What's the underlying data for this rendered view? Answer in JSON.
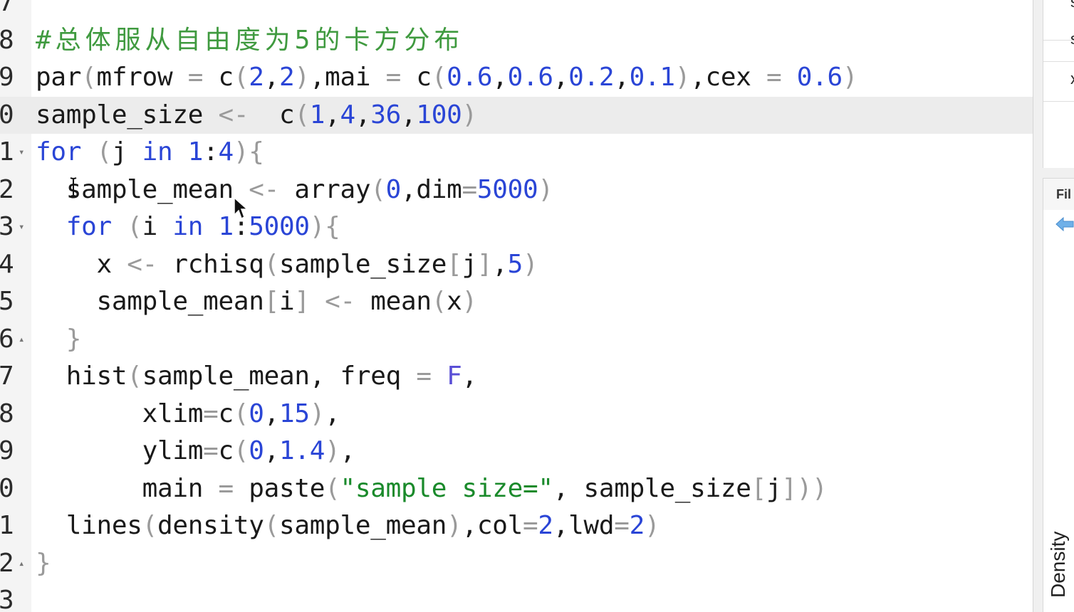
{
  "editor": {
    "lines": [
      {
        "num": "7",
        "fold": "",
        "tokens": []
      },
      {
        "num": "8",
        "fold": "",
        "tokens": [
          {
            "t": "comment",
            "v": "#总体服从自由度为5的卡方分布"
          }
        ]
      },
      {
        "num": "9",
        "fold": "",
        "tokens": [
          {
            "t": "default",
            "v": "par"
          },
          {
            "t": "paren",
            "v": "("
          },
          {
            "t": "default",
            "v": "mfrow "
          },
          {
            "t": "op",
            "v": "="
          },
          {
            "t": "default",
            "v": " c"
          },
          {
            "t": "paren",
            "v": "("
          },
          {
            "t": "number",
            "v": "2"
          },
          {
            "t": "default",
            "v": ","
          },
          {
            "t": "number",
            "v": "2"
          },
          {
            "t": "paren",
            "v": ")"
          },
          {
            "t": "default",
            "v": ",mai "
          },
          {
            "t": "op",
            "v": "="
          },
          {
            "t": "default",
            "v": " c"
          },
          {
            "t": "paren",
            "v": "("
          },
          {
            "t": "number",
            "v": "0.6"
          },
          {
            "t": "default",
            "v": ","
          },
          {
            "t": "number",
            "v": "0.6"
          },
          {
            "t": "default",
            "v": ","
          },
          {
            "t": "number",
            "v": "0.2"
          },
          {
            "t": "default",
            "v": ","
          },
          {
            "t": "number",
            "v": "0.1"
          },
          {
            "t": "paren",
            "v": ")"
          },
          {
            "t": "default",
            "v": ",cex "
          },
          {
            "t": "op",
            "v": "="
          },
          {
            "t": "default",
            "v": " "
          },
          {
            "t": "number",
            "v": "0.6"
          },
          {
            "t": "paren",
            "v": ")"
          }
        ]
      },
      {
        "num": "0",
        "fold": "",
        "current": true,
        "tokens": [
          {
            "t": "default",
            "v": "sample_size "
          },
          {
            "t": "op",
            "v": "<-"
          },
          {
            "t": "default",
            "v": "  c"
          },
          {
            "t": "paren",
            "v": "("
          },
          {
            "t": "number",
            "v": "1"
          },
          {
            "t": "default",
            "v": ","
          },
          {
            "t": "number",
            "v": "4"
          },
          {
            "t": "default",
            "v": ","
          },
          {
            "t": "number",
            "v": "36"
          },
          {
            "t": "default",
            "v": ","
          },
          {
            "t": "number",
            "v": "100"
          },
          {
            "t": "paren",
            "v": ")"
          }
        ]
      },
      {
        "num": "1",
        "fold": "▾",
        "tokens": [
          {
            "t": "keyword",
            "v": "for"
          },
          {
            "t": "default",
            "v": " "
          },
          {
            "t": "paren",
            "v": "("
          },
          {
            "t": "default",
            "v": "j "
          },
          {
            "t": "keyword",
            "v": "in"
          },
          {
            "t": "default",
            "v": " "
          },
          {
            "t": "number",
            "v": "1"
          },
          {
            "t": "default",
            "v": ":"
          },
          {
            "t": "number",
            "v": "4"
          },
          {
            "t": "paren",
            "v": ")"
          },
          {
            "t": "paren",
            "v": "{"
          }
        ]
      },
      {
        "num": "2",
        "fold": "",
        "tokens": [
          {
            "t": "default",
            "v": "  sample_mean "
          },
          {
            "t": "op",
            "v": "<-"
          },
          {
            "t": "default",
            "v": " array"
          },
          {
            "t": "paren",
            "v": "("
          },
          {
            "t": "number",
            "v": "0"
          },
          {
            "t": "default",
            "v": ",dim"
          },
          {
            "t": "op",
            "v": "="
          },
          {
            "t": "number",
            "v": "5000"
          },
          {
            "t": "paren",
            "v": ")"
          }
        ]
      },
      {
        "num": "3",
        "fold": "▾",
        "tokens": [
          {
            "t": "default",
            "v": "  "
          },
          {
            "t": "keyword",
            "v": "for"
          },
          {
            "t": "default",
            "v": " "
          },
          {
            "t": "paren",
            "v": "("
          },
          {
            "t": "default",
            "v": "i "
          },
          {
            "t": "keyword",
            "v": "in"
          },
          {
            "t": "default",
            "v": " "
          },
          {
            "t": "number",
            "v": "1"
          },
          {
            "t": "default",
            "v": ":"
          },
          {
            "t": "number",
            "v": "5000"
          },
          {
            "t": "paren",
            "v": ")"
          },
          {
            "t": "paren",
            "v": "{"
          }
        ]
      },
      {
        "num": "4",
        "fold": "",
        "tokens": [
          {
            "t": "default",
            "v": "    x "
          },
          {
            "t": "op",
            "v": "<-"
          },
          {
            "t": "default",
            "v": " rchisq"
          },
          {
            "t": "paren",
            "v": "("
          },
          {
            "t": "default",
            "v": "sample_size"
          },
          {
            "t": "paren",
            "v": "["
          },
          {
            "t": "default",
            "v": "j"
          },
          {
            "t": "paren",
            "v": "]"
          },
          {
            "t": "default",
            "v": ","
          },
          {
            "t": "number",
            "v": "5"
          },
          {
            "t": "paren",
            "v": ")"
          }
        ]
      },
      {
        "num": "5",
        "fold": "",
        "tokens": [
          {
            "t": "default",
            "v": "    sample_mean"
          },
          {
            "t": "paren",
            "v": "["
          },
          {
            "t": "default",
            "v": "i"
          },
          {
            "t": "paren",
            "v": "]"
          },
          {
            "t": "default",
            "v": " "
          },
          {
            "t": "op",
            "v": "<-"
          },
          {
            "t": "default",
            "v": " mean"
          },
          {
            "t": "paren",
            "v": "("
          },
          {
            "t": "default",
            "v": "x"
          },
          {
            "t": "paren",
            "v": ")"
          }
        ]
      },
      {
        "num": "6",
        "fold": "▴",
        "tokens": [
          {
            "t": "default",
            "v": "  "
          },
          {
            "t": "paren",
            "v": "}"
          }
        ]
      },
      {
        "num": "7",
        "fold": "",
        "tokens": [
          {
            "t": "default",
            "v": "  hist"
          },
          {
            "t": "paren",
            "v": "("
          },
          {
            "t": "default",
            "v": "sample_mean, freq "
          },
          {
            "t": "op",
            "v": "="
          },
          {
            "t": "default",
            "v": " "
          },
          {
            "t": "const",
            "v": "F"
          },
          {
            "t": "default",
            "v": ","
          }
        ]
      },
      {
        "num": "8",
        "fold": "",
        "tokens": [
          {
            "t": "default",
            "v": "       xlim"
          },
          {
            "t": "op",
            "v": "="
          },
          {
            "t": "default",
            "v": "c"
          },
          {
            "t": "paren",
            "v": "("
          },
          {
            "t": "number",
            "v": "0"
          },
          {
            "t": "default",
            "v": ","
          },
          {
            "t": "number",
            "v": "15"
          },
          {
            "t": "paren",
            "v": ")"
          },
          {
            "t": "default",
            "v": ","
          }
        ]
      },
      {
        "num": "9",
        "fold": "",
        "tokens": [
          {
            "t": "default",
            "v": "       ylim"
          },
          {
            "t": "op",
            "v": "="
          },
          {
            "t": "default",
            "v": "c"
          },
          {
            "t": "paren",
            "v": "("
          },
          {
            "t": "number",
            "v": "0"
          },
          {
            "t": "default",
            "v": ","
          },
          {
            "t": "number",
            "v": "1.4"
          },
          {
            "t": "paren",
            "v": ")"
          },
          {
            "t": "default",
            "v": ","
          }
        ]
      },
      {
        "num": "0",
        "fold": "",
        "tokens": [
          {
            "t": "default",
            "v": "       main "
          },
          {
            "t": "op",
            "v": "="
          },
          {
            "t": "default",
            "v": " paste"
          },
          {
            "t": "paren",
            "v": "("
          },
          {
            "t": "string",
            "v": "\"sample size=\""
          },
          {
            "t": "default",
            "v": ", sample_size"
          },
          {
            "t": "paren",
            "v": "["
          },
          {
            "t": "default",
            "v": "j"
          },
          {
            "t": "paren",
            "v": "]"
          },
          {
            "t": "paren",
            "v": ")"
          },
          {
            "t": "paren",
            "v": ")"
          }
        ]
      },
      {
        "num": "1",
        "fold": "",
        "tokens": [
          {
            "t": "default",
            "v": "  lines"
          },
          {
            "t": "paren",
            "v": "("
          },
          {
            "t": "default",
            "v": "density"
          },
          {
            "t": "paren",
            "v": "("
          },
          {
            "t": "default",
            "v": "sample_mean"
          },
          {
            "t": "paren",
            "v": ")"
          },
          {
            "t": "default",
            "v": ",col"
          },
          {
            "t": "op",
            "v": "="
          },
          {
            "t": "number",
            "v": "2"
          },
          {
            "t": "default",
            "v": ",lwd"
          },
          {
            "t": "op",
            "v": "="
          },
          {
            "t": "number",
            "v": "2"
          },
          {
            "t": "paren",
            "v": ")"
          }
        ]
      },
      {
        "num": "2",
        "fold": "▴",
        "tokens": [
          {
            "t": "paren",
            "v": "}"
          }
        ]
      },
      {
        "num": "3",
        "fold": "",
        "tokens": []
      }
    ]
  },
  "right_panel": {
    "top_glyphs": [
      "s",
      "",
      "x"
    ],
    "files_tab_label": "Fil",
    "plot_ylabel": "Density"
  },
  "colors": {
    "keyword": "#2a45d6",
    "number": "#2a45d6",
    "string": "#1a8a2b",
    "comment": "#3f9a3f",
    "current_line": "#ececec",
    "accent_icon": "#6fb0e8"
  },
  "icons": {
    "back": "arrow-left-icon",
    "text_cursor": "i-beam-cursor-icon",
    "mouse": "mouse-pointer-icon"
  }
}
